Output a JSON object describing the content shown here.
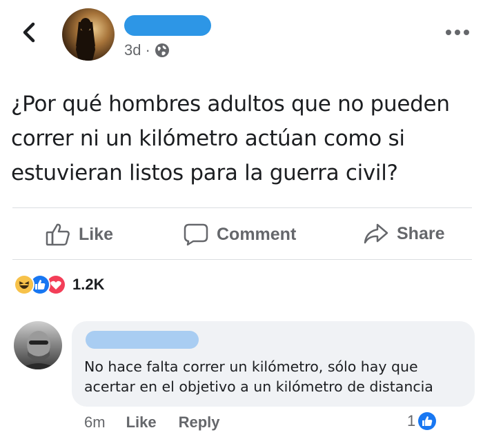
{
  "post": {
    "time": "3d",
    "separator": "·",
    "text": "¿Por qué hombres adultos que no pueden correr ni un kilómetro actúan como si estuvieran listos para la guerra civil?"
  },
  "actions": {
    "like": "Like",
    "comment": "Comment",
    "share": "Share"
  },
  "reactions": {
    "icons": [
      "haha-icon",
      "like-icon",
      "love-icon"
    ],
    "count": "1.2K"
  },
  "comment": {
    "text": "No hace falta correr un kilómetro, sólo hay que acertar en el objetivo a un kilómetro de distancia",
    "time": "6m",
    "like_label": "Like",
    "reply_label": "Reply",
    "likes_count": "1"
  },
  "colors": {
    "accent": "#1877f2",
    "name_redaction": "#2d96e6",
    "commenter_redaction": "#a9cdf2",
    "muted_text": "#65676b",
    "bubble": "#f0f2f5"
  }
}
